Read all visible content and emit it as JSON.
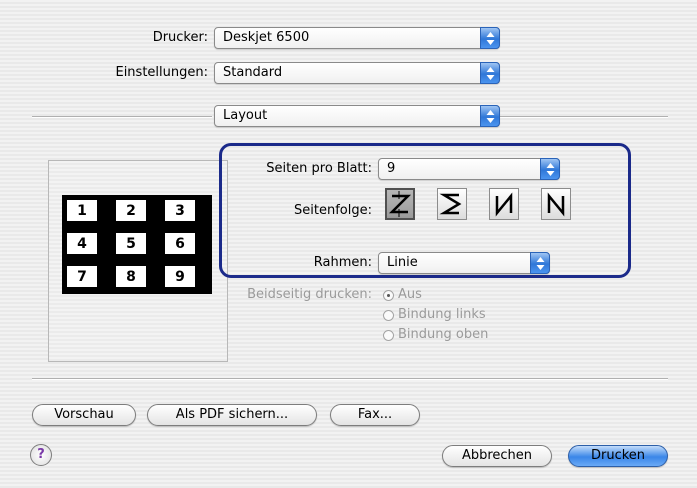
{
  "printer": {
    "label": "Drucker:",
    "value": "Deskjet 6500"
  },
  "presets": {
    "label": "Einstellungen:",
    "value": "Standard"
  },
  "panel": {
    "value": "Layout"
  },
  "layout": {
    "pages_per_sheet": {
      "label": "Seiten pro Blatt:",
      "value": "9"
    },
    "page_order": {
      "label": "Seitenfolge:",
      "options": [
        "Z",
        "S",
        "N-reversed",
        "N"
      ],
      "selected_index": 0
    },
    "border": {
      "label": "Rahmen:",
      "value": "Linie"
    },
    "preview_grid": [
      "1",
      "2",
      "3",
      "4",
      "5",
      "6",
      "7",
      "8",
      "9"
    ],
    "highlight_color": "#1b2a8a"
  },
  "duplex": {
    "label": "Beidseitig drucken:",
    "options": [
      "Aus",
      "Bindung links",
      "Bindung oben"
    ],
    "selected": "Aus"
  },
  "buttons": {
    "preview": "Vorschau",
    "save_pdf": "Als PDF sichern...",
    "fax": "Fax...",
    "cancel": "Abbrechen",
    "print": "Drucken",
    "help": "?"
  }
}
